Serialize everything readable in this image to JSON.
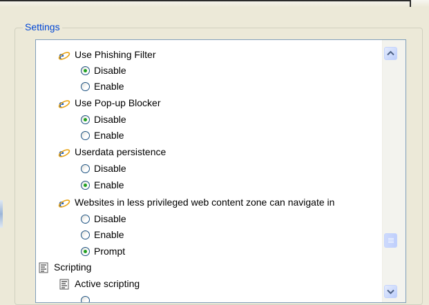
{
  "group": {
    "title": "Settings"
  },
  "settings": [
    {
      "title": "Use Phishing Filter",
      "icon": "ie-icon",
      "options": [
        {
          "label": "Disable",
          "checked": true
        },
        {
          "label": "Enable",
          "checked": false
        }
      ]
    },
    {
      "title": "Use Pop-up Blocker",
      "icon": "ie-icon",
      "options": [
        {
          "label": "Disable",
          "checked": true
        },
        {
          "label": "Enable",
          "checked": false
        }
      ]
    },
    {
      "title": "Userdata persistence",
      "icon": "ie-icon",
      "options": [
        {
          "label": "Disable",
          "checked": false
        },
        {
          "label": "Enable",
          "checked": true
        }
      ]
    },
    {
      "title": "Websites in less privileged web content zone can navigate in",
      "icon": "ie-icon",
      "options": [
        {
          "label": "Disable",
          "checked": false
        },
        {
          "label": "Enable",
          "checked": false
        },
        {
          "label": "Prompt",
          "checked": true
        }
      ]
    }
  ],
  "category": {
    "title": "Scripting",
    "icon": "script-icon"
  },
  "subsetting": {
    "title": "Active scripting",
    "icon": "script-icon"
  },
  "scrollbar": {
    "up_icon": "chevron-up-icon",
    "down_icon": "chevron-down-icon"
  },
  "colors": {
    "group_label": "#0046d5",
    "radio_dot": "#21a121",
    "frame_border": "#7f9db9"
  }
}
